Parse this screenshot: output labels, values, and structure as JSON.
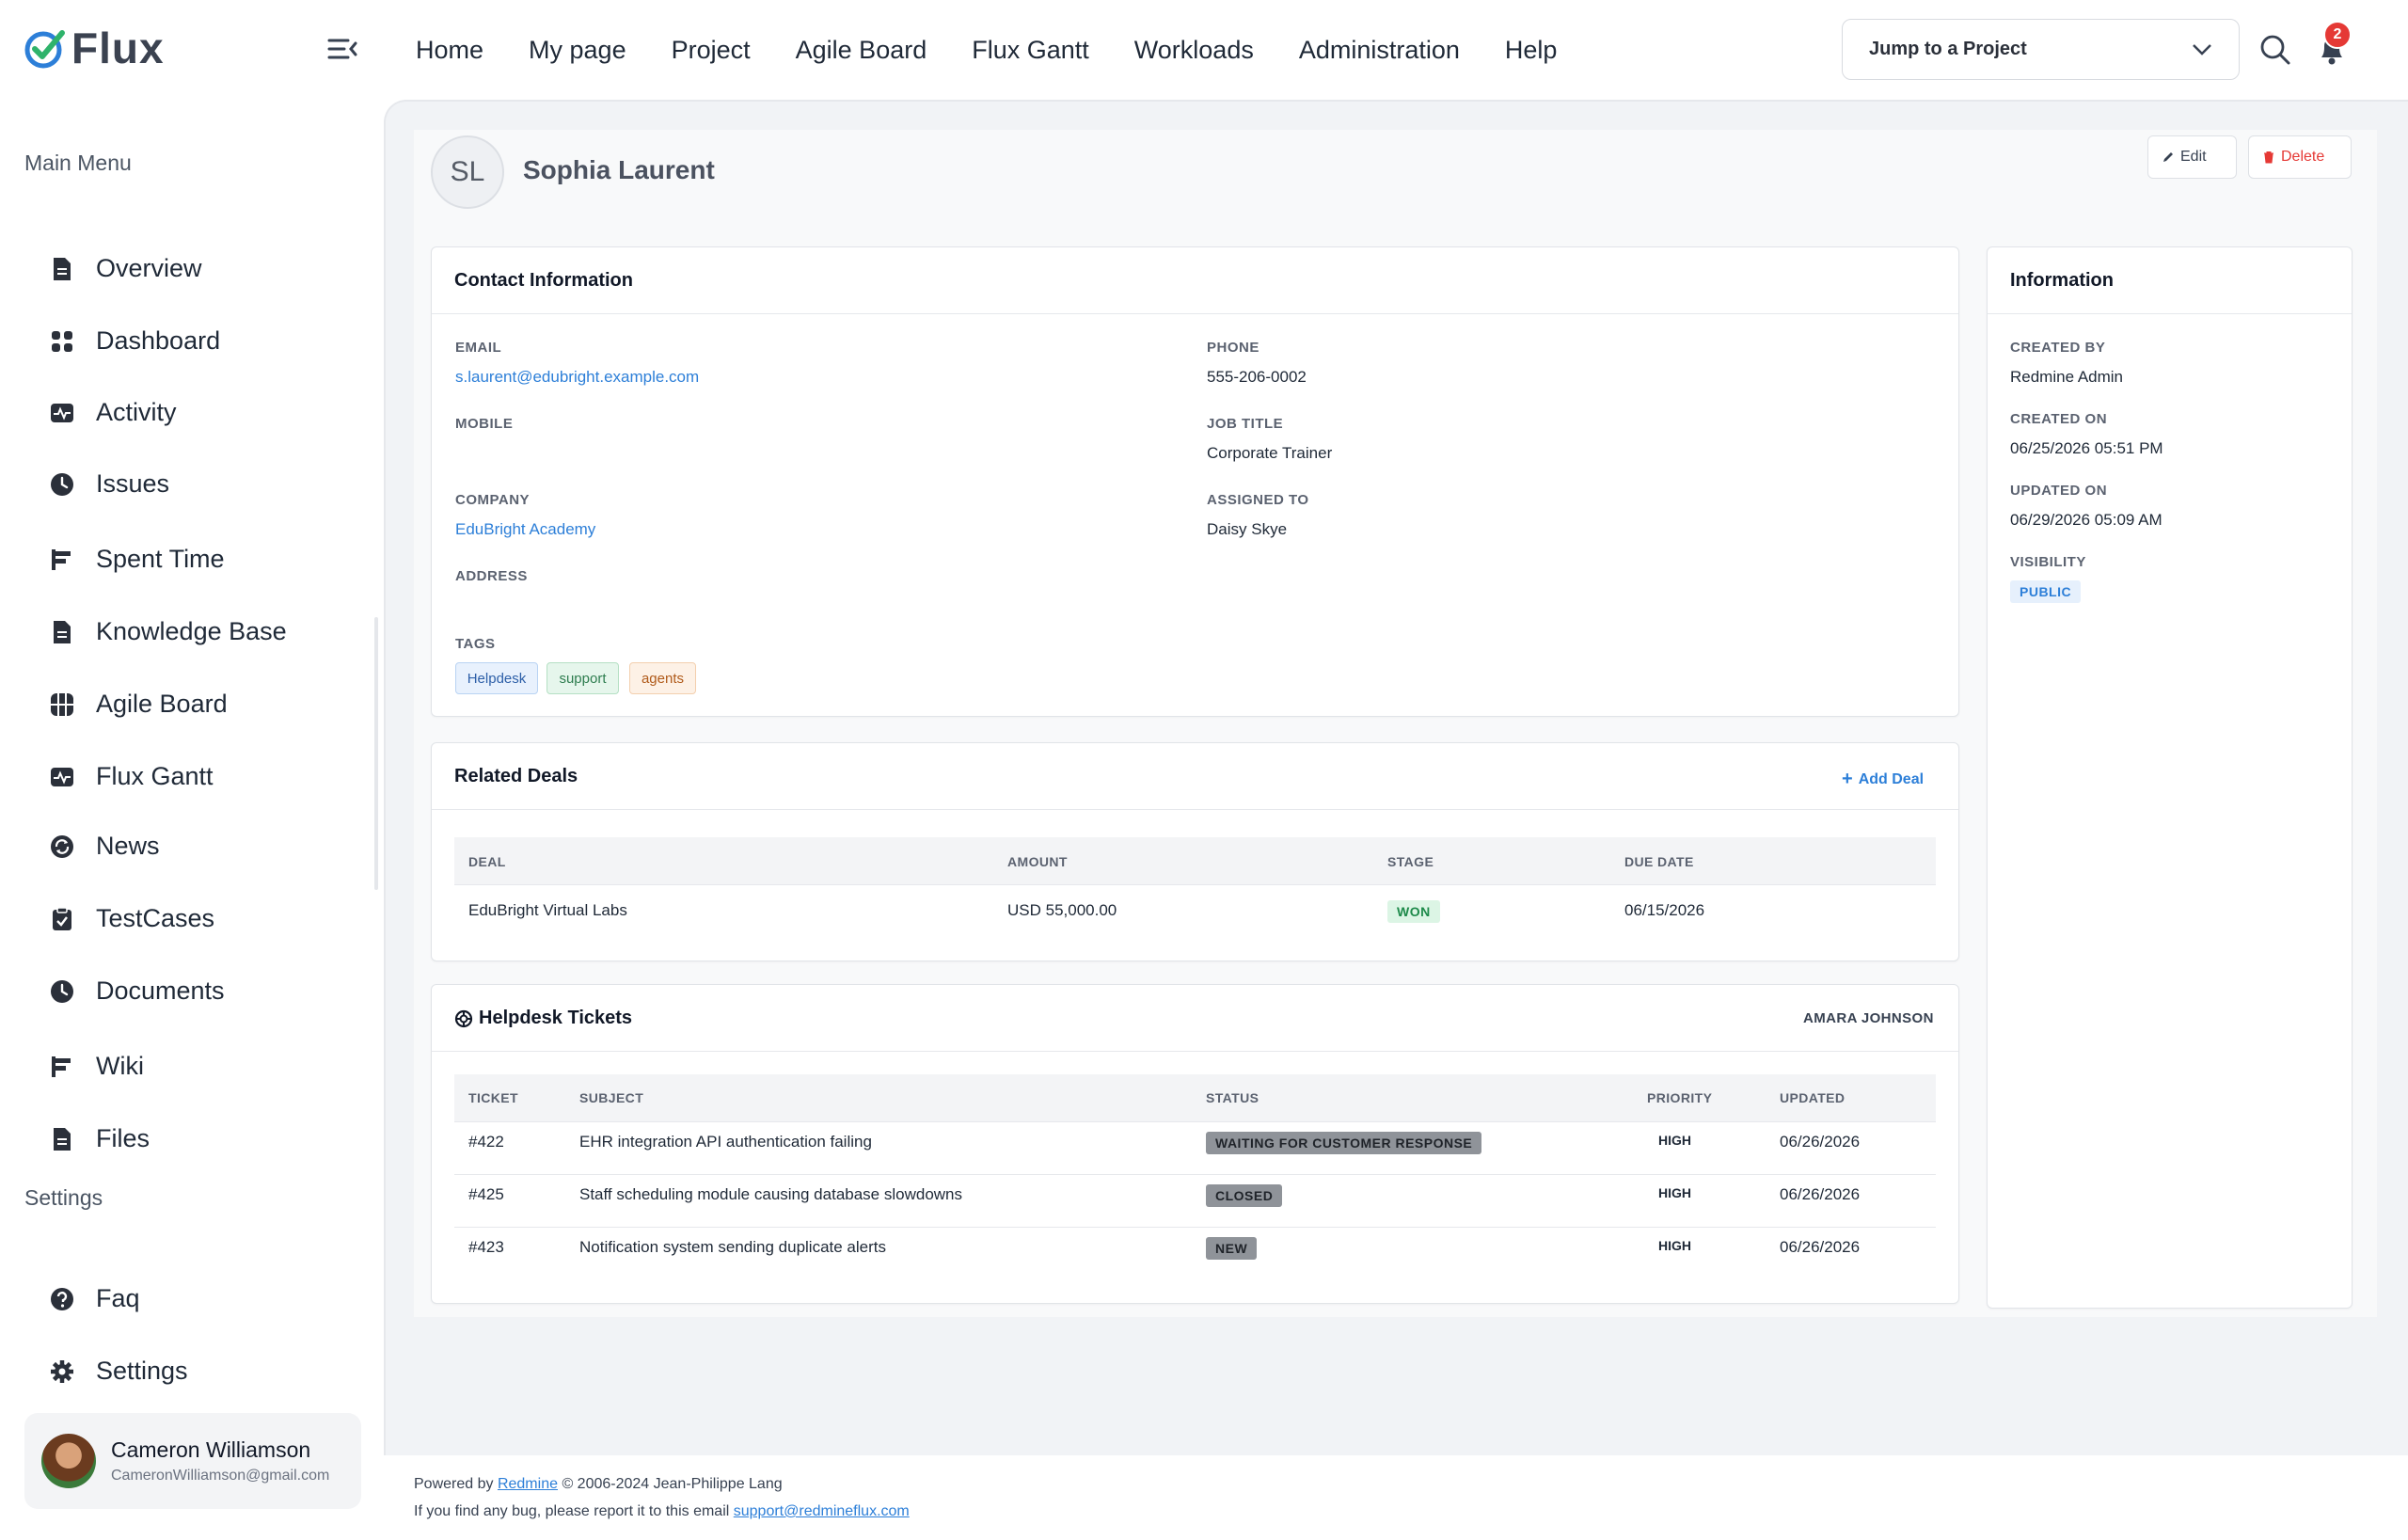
{
  "app": {
    "name": "Flux",
    "brand_color": "#2d7fd8"
  },
  "topnav": [
    "Home",
    "My page",
    "Project",
    "Agile Board",
    "Flux Gantt",
    "Workloads",
    "Administration",
    "Help"
  ],
  "jump": {
    "label": "Jump to a Project"
  },
  "notifications": {
    "count": "2"
  },
  "sidebar": {
    "main_heading": "Main Menu",
    "items": [
      {
        "label": "Overview",
        "icon": "document-icon"
      },
      {
        "label": "Dashboard",
        "icon": "grid-icon"
      },
      {
        "label": "Activity",
        "icon": "pulse-icon"
      },
      {
        "label": "Issues",
        "icon": "clock-icon"
      },
      {
        "label": "Spent Time",
        "icon": "bars-icon"
      },
      {
        "label": "Knowledge Base",
        "icon": "document-icon"
      },
      {
        "label": "Agile Board",
        "icon": "board-icon"
      },
      {
        "label": "Flux Gantt",
        "icon": "pulse-icon"
      },
      {
        "label": "News",
        "icon": "refresh-icon"
      },
      {
        "label": "TestCases",
        "icon": "clipboard-icon"
      },
      {
        "label": "Documents",
        "icon": "clock-icon"
      },
      {
        "label": "Wiki",
        "icon": "bars-icon"
      },
      {
        "label": "Files",
        "icon": "document-icon"
      }
    ],
    "settings_heading": "Settings",
    "settings_items": [
      {
        "label": "Faq",
        "icon": "question-icon"
      },
      {
        "label": "Settings",
        "icon": "gear-icon"
      }
    ]
  },
  "user": {
    "name": "Cameron Williamson",
    "email": "CameronWilliamson@gmail.com"
  },
  "contact": {
    "initials": "SL",
    "name": "Sophia Laurent",
    "edit_label": "Edit",
    "delete_label": "Delete"
  },
  "contact_info": {
    "title": "Contact Information",
    "email_label": "EMAIL",
    "email": "s.laurent@edubright.example.com",
    "phone_label": "PHONE",
    "phone": "555-206-0002",
    "mobile_label": "MOBILE",
    "job_label": "JOB TITLE",
    "job": "Corporate Trainer",
    "company_label": "COMPANY",
    "company": "EduBright Academy",
    "assigned_label": "ASSIGNED TO",
    "assigned": "Daisy Skye",
    "address_label": "ADDRESS",
    "tags_label": "TAGS",
    "tags": [
      {
        "label": "Helpdesk",
        "bg": "#e8f1fd",
        "fg": "#2d5fa8",
        "border": "#b9d3f3"
      },
      {
        "label": "support",
        "bg": "#e6f6ec",
        "fg": "#2e7d4f",
        "border": "#b5e0c4"
      },
      {
        "label": "agents",
        "bg": "#fdf1e6",
        "fg": "#b05a1a",
        "border": "#f3cfae"
      }
    ]
  },
  "info": {
    "title": "Information",
    "created_by_label": "CREATED BY",
    "created_by": "Redmine Admin",
    "created_on_label": "CREATED ON",
    "created_on": "06/25/2026 05:51 PM",
    "updated_on_label": "UPDATED ON",
    "updated_on": "06/29/2026 05:09 AM",
    "visibility_label": "VISIBILITY",
    "visibility": "PUBLIC"
  },
  "deals": {
    "title": "Related Deals",
    "add_label": "Add Deal",
    "columns": [
      "DEAL",
      "AMOUNT",
      "STAGE",
      "DUE DATE"
    ],
    "rows": [
      {
        "deal": "EduBright Virtual Labs",
        "amount": "USD 55,000.00",
        "stage": "WON",
        "due": "06/15/2026"
      }
    ]
  },
  "tickets": {
    "title": "Helpdesk Tickets",
    "assignee": "AMARA JOHNSON",
    "columns": [
      "TICKET",
      "SUBJECT",
      "STATUS",
      "PRIORITY",
      "UPDATED"
    ],
    "rows": [
      {
        "id": "#422",
        "subject": "EHR integration API authentication failing",
        "status": "WAITING FOR CUSTOMER RESPONSE",
        "priority": "HIGH",
        "updated": "06/26/2026"
      },
      {
        "id": "#425",
        "subject": "Staff scheduling module causing database slowdowns",
        "status": "CLOSED",
        "priority": "HIGH",
        "updated": "06/26/2026"
      },
      {
        "id": "#423",
        "subject": "Notification system sending duplicate alerts",
        "status": "NEW",
        "priority": "HIGH",
        "updated": "06/26/2026"
      }
    ]
  },
  "footer": {
    "powered_prefix": "Powered by",
    "powered_link": "Redmine",
    "powered_suffix": "© 2006-2024 Jean-Philippe Lang",
    "bug_text": "If you find any bug, please report it to this email",
    "bug_email": "support@redmineflux.com"
  }
}
